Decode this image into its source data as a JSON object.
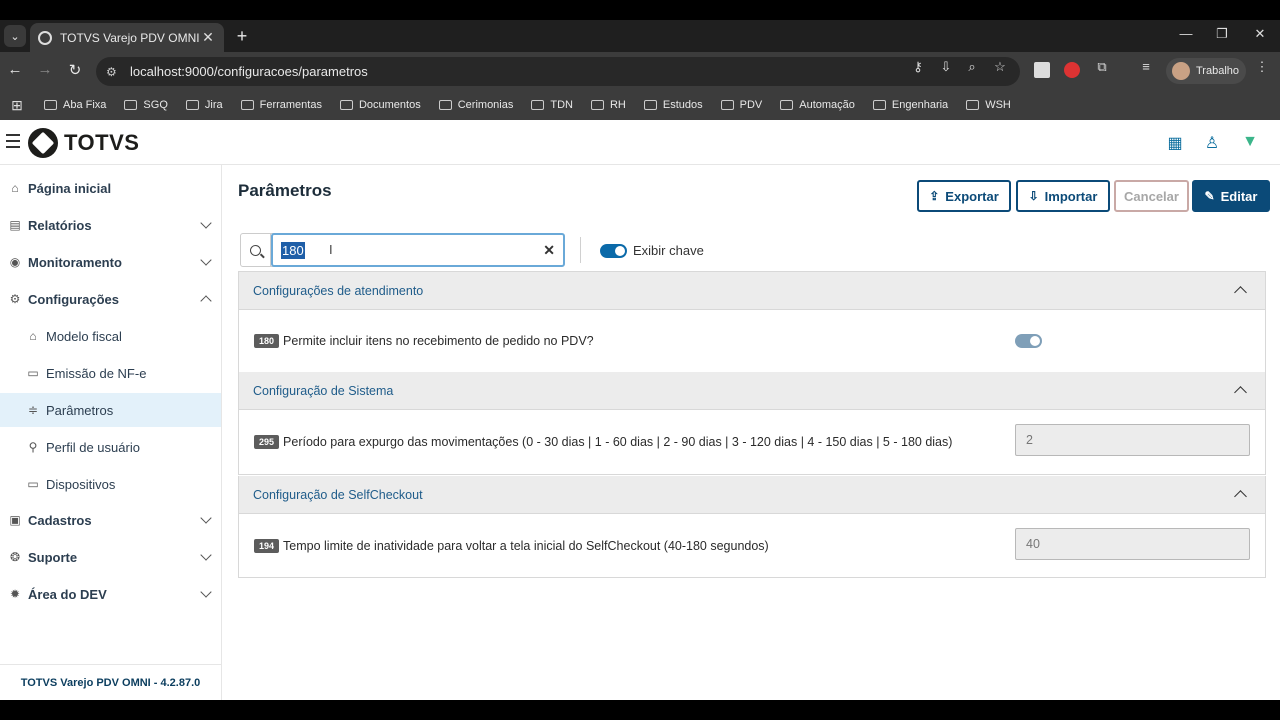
{
  "browser": {
    "tab_title": "TOTVS Varejo PDV OMNI",
    "url": "localhost:9000/configuracoes/parametros",
    "profile_name": "Trabalho",
    "bookmarks": [
      "Aba Fixa",
      "SGQ",
      "Jira",
      "Ferramentas",
      "Documentos",
      "Cerimonias",
      "TDN",
      "RH",
      "Estudos",
      "PDV",
      "Automação",
      "Engenharia",
      "WSH"
    ]
  },
  "app": {
    "logo": "TOTVS",
    "footer": "TOTVS Varejo PDV OMNI - 4.2.87.0"
  },
  "sidebar": {
    "items": [
      {
        "label": "Página inicial",
        "icon": "home-icon"
      },
      {
        "label": "Relatórios",
        "icon": "report-icon"
      },
      {
        "label": "Monitoramento",
        "icon": "broadcast-icon"
      },
      {
        "label": "Configurações",
        "icon": "gear-icon"
      },
      {
        "label": "Cadastros",
        "icon": "briefcase-icon"
      },
      {
        "label": "Suporte",
        "icon": "lifebuoy-icon"
      },
      {
        "label": "Área do DEV",
        "icon": "bug-icon"
      }
    ],
    "sub_items": [
      {
        "label": "Modelo fiscal",
        "icon": "bank-icon"
      },
      {
        "label": "Emissão de NF-e",
        "icon": "document-icon"
      },
      {
        "label": "Parâmetros",
        "icon": "sliders-icon"
      },
      {
        "label": "Perfil de usuário",
        "icon": "user-key-icon"
      },
      {
        "label": "Dispositivos",
        "icon": "monitor-icon"
      }
    ]
  },
  "main": {
    "title": "Parâmetros",
    "buttons": {
      "export": "Exportar",
      "import": "Importar",
      "cancel": "Cancelar",
      "edit": "Editar"
    },
    "search_value": "180",
    "toggle_label": "Exibir chave",
    "groups": [
      {
        "title": "Configurações de atendimento",
        "rows": [
          {
            "key": "180",
            "label": "Permite incluir itens no recebimento de pedido no PDV?",
            "type": "toggle"
          }
        ]
      },
      {
        "title": "Configuração de Sistema",
        "rows": [
          {
            "key": "295",
            "label": "Período para expurgo das movimentações (0 - 30 dias | 1 - 60 dias | 2 - 90 dias | 3 - 120 dias | 4 - 150 dias | 5 - 180 dias)",
            "type": "input",
            "value": "2"
          }
        ]
      },
      {
        "title": "Configuração de SelfCheckout",
        "rows": [
          {
            "key": "194",
            "label": "Tempo limite de inatividade para voltar a tela inicial do SelfCheckout (40-180 segundos)",
            "type": "input",
            "value": "40"
          }
        ]
      }
    ]
  },
  "colors": {
    "primary": "#0b4a78",
    "link": "#1f5c8a",
    "active_bg": "#e3f1fa"
  }
}
